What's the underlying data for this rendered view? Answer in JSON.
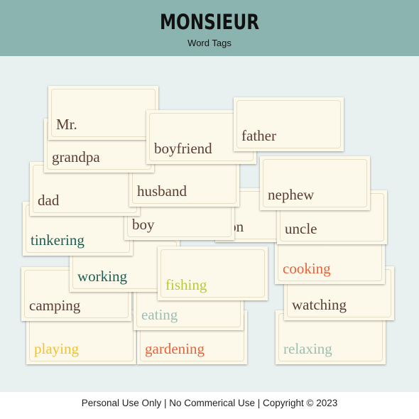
{
  "header": {
    "title": "MONSIEUR",
    "subtitle": "Word Tags"
  },
  "colors": {
    "header_bg": "#8bb3b0",
    "background": "#e8f1f0",
    "card": "#fdf9ea",
    "brown": "#5a3e32",
    "teal": "#1d5e55",
    "lime": "#b5cc3a",
    "light_teal": "#9bbfb4",
    "orange": "#e8623a",
    "yellow": "#f2c230"
  },
  "tags": {
    "playing": "playing",
    "gardening": "gardening",
    "relaxing": "relaxing",
    "eating": "eating",
    "camping": "camping",
    "watching": "watching",
    "working": "working",
    "cooking": "cooking",
    "tinkering": "tinkering",
    "son": "son",
    "uncle": "uncle",
    "boy": "boy",
    "fishing": "fishing",
    "dad": "dad",
    "husband": "husband",
    "nephew": "nephew",
    "grandpa": "grandpa",
    "mr": "Mr.",
    "boyfriend": "boyfriend",
    "father": "father"
  },
  "footer": {
    "text": "Personal Use Only  |  No Commerical Use  |  Copyright © 2023"
  }
}
